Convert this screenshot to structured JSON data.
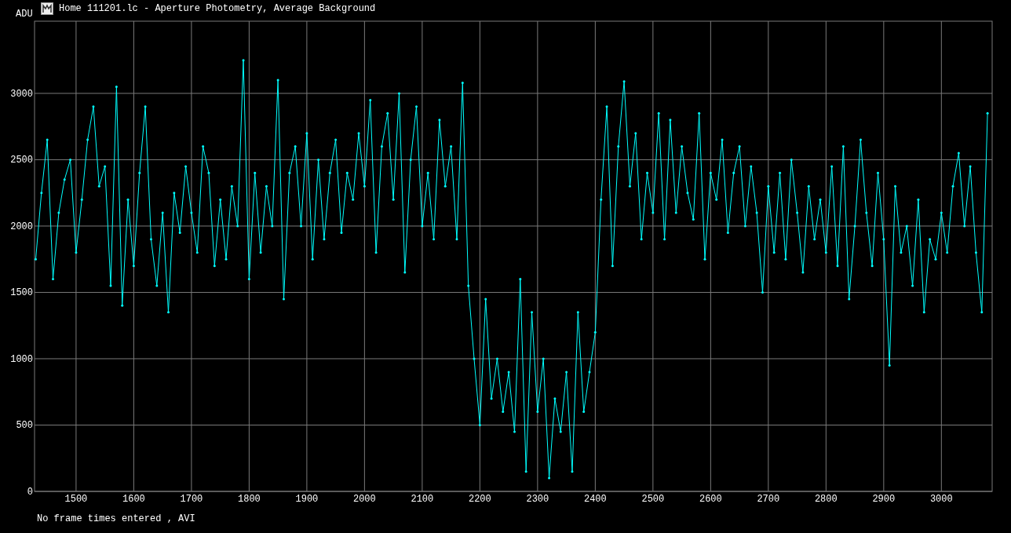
{
  "window": {
    "title": "Home 111201.lc - Aperture Photometry, Average Background"
  },
  "chart_data": {
    "type": "line",
    "grid": true,
    "ylabel": "ADU",
    "xlim": [
      1428,
      3088
    ],
    "ylim": [
      0,
      3544
    ],
    "xticks": [
      1500,
      1600,
      1700,
      1800,
      1900,
      2000,
      2100,
      2200,
      2300,
      2400,
      2500,
      2600,
      2700,
      2800,
      2900,
      3000
    ],
    "yticks": [
      0,
      500,
      1000,
      1500,
      2000,
      2500,
      3000
    ],
    "x": [
      1430,
      1440,
      1450,
      1460,
      1470,
      1480,
      1490,
      1500,
      1510,
      1520,
      1530,
      1540,
      1550,
      1560,
      1570,
      1580,
      1590,
      1600,
      1610,
      1620,
      1630,
      1640,
      1650,
      1660,
      1670,
      1680,
      1690,
      1700,
      1710,
      1720,
      1730,
      1740,
      1750,
      1760,
      1770,
      1780,
      1790,
      1800,
      1810,
      1820,
      1830,
      1840,
      1850,
      1860,
      1870,
      1880,
      1890,
      1900,
      1910,
      1920,
      1930,
      1940,
      1950,
      1960,
      1970,
      1980,
      1990,
      2000,
      2010,
      2020,
      2030,
      2040,
      2050,
      2060,
      2070,
      2080,
      2090,
      2100,
      2110,
      2120,
      2130,
      2140,
      2150,
      2160,
      2170,
      2180,
      2190,
      2200,
      2210,
      2220,
      2230,
      2240,
      2250,
      2260,
      2270,
      2280,
      2290,
      2300,
      2310,
      2320,
      2330,
      2340,
      2350,
      2360,
      2370,
      2380,
      2390,
      2400,
      2410,
      2420,
      2430,
      2440,
      2450,
      2460,
      2470,
      2480,
      2490,
      2500,
      2510,
      2520,
      2530,
      2540,
      2550,
      2560,
      2570,
      2580,
      2590,
      2600,
      2610,
      2620,
      2630,
      2640,
      2650,
      2660,
      2670,
      2680,
      2690,
      2700,
      2710,
      2720,
      2730,
      2740,
      2750,
      2760,
      2770,
      2780,
      2790,
      2800,
      2810,
      2820,
      2830,
      2840,
      2850,
      2860,
      2870,
      2880,
      2890,
      2900,
      2910,
      2920,
      2930,
      2940,
      2950,
      2960,
      2970,
      2980,
      2990,
      3000,
      3010,
      3020,
      3030,
      3040,
      3050,
      3060,
      3070,
      3080
    ],
    "series": [
      {
        "color": "#00ffff",
        "values": [
          1750,
          2250,
          2650,
          1600,
          2100,
          2350,
          2500,
          1800,
          2200,
          2650,
          2900,
          2300,
          2450,
          1550,
          3050,
          1400,
          2200,
          1700,
          2400,
          2900,
          1900,
          1550,
          2100,
          1350,
          2250,
          1950,
          2450,
          2100,
          1800,
          2600,
          2400,
          1700,
          2200,
          1750,
          2300,
          2000,
          3250,
          1600,
          2400,
          1800,
          2300,
          2000,
          3100,
          1450,
          2400,
          2600,
          2000,
          2700,
          1750,
          2500,
          1900,
          2400,
          2650,
          1950,
          2400,
          2200,
          2700,
          2300,
          2950,
          1800,
          2600,
          2850,
          2200,
          3000,
          1650,
          2500,
          2900,
          2000,
          2400,
          1900,
          2800,
          2300,
          2600,
          1900,
          3080,
          1550,
          1000,
          500,
          1450,
          700,
          1000,
          600,
          900,
          450,
          1600,
          150,
          1350,
          600,
          1000,
          100,
          700,
          450,
          900,
          150,
          1350,
          600,
          900,
          1200,
          2200,
          2900,
          1700,
          2600,
          3090,
          2300,
          2700,
          1900,
          2400,
          2100,
          2850,
          1900,
          2800,
          2100,
          2600,
          2250,
          2050,
          2850,
          1750,
          2400,
          2200,
          2650,
          1950,
          2400,
          2600,
          2000,
          2450,
          2100,
          1500,
          2300,
          1800,
          2400,
          1750,
          2500,
          2100,
          1650,
          2300,
          1900,
          2200,
          1800,
          2450,
          1700,
          2600,
          1450,
          2000,
          2650,
          2100,
          1700,
          2400,
          1900,
          950,
          2300,
          1800,
          2000,
          1550,
          2200,
          1350,
          1900,
          1750,
          2100,
          1800,
          2300,
          2550,
          2000,
          2450,
          1800,
          1350,
          2850
        ]
      }
    ]
  },
  "status_bar": {
    "text": "No frame times entered , AVI"
  }
}
